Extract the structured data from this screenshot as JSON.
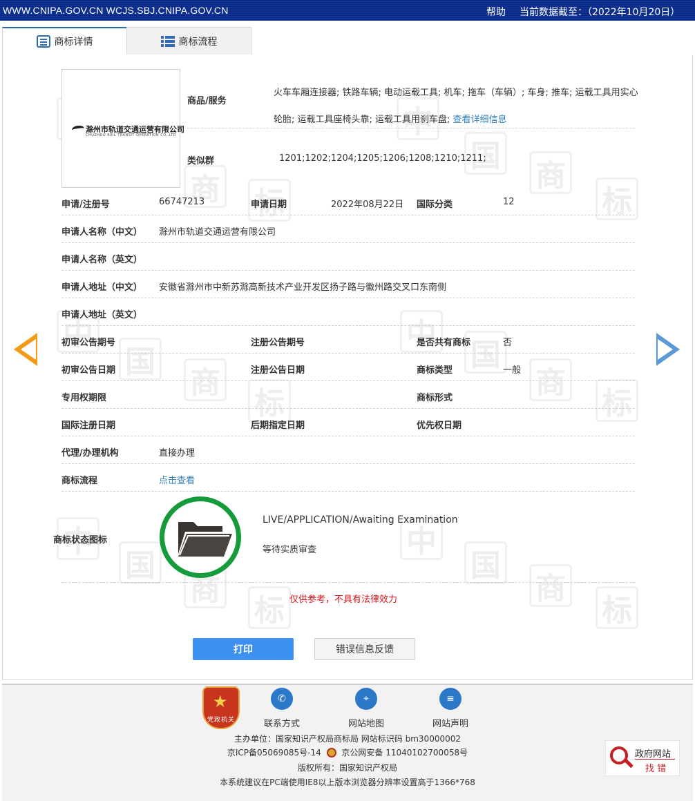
{
  "topbar": {
    "sites": "WWW.CNIPA.GOV.CN WCJS.SBJ.CNIPA.GOV.CN",
    "help": "帮助",
    "as_of": "当前数据截至：（2022年10月20日）"
  },
  "tabs": [
    {
      "label": "商标详情",
      "icon": "detail-icon",
      "active": true
    },
    {
      "label": "商标流程",
      "icon": "list-icon",
      "active": false
    }
  ],
  "watermark": [
    "中",
    "国",
    "商",
    "标"
  ],
  "trademark": {
    "logo_cn": "滁州市轨道交通运营有限公司",
    "logo_en": "CHUZHOU RAIL TRANSIT OPERATION CO.,LTD",
    "goods_label": "商品/服务",
    "goods_text": "火车车厢连接器; 铁路车辆; 电动运载工具; 机车; 拖车（车辆）; 车身; 推车; 运载工具用实心轮胎; 运载工具座椅头靠; 运载工具用刹车盘;",
    "goods_link": "查看详细信息",
    "similar_label": "类似群",
    "similar_value": "1201;1202;1204;1205;1206;1208;1210;1211;"
  },
  "fields": {
    "reg_no_label": "申请/注册号",
    "reg_no": "66747213",
    "apply_date_label": "申请日期",
    "apply_date": "2022年08月22日",
    "intl_class_label": "国际分类",
    "intl_class": "12",
    "applicant_cn_label": "申请人名称（中文）",
    "applicant_cn": "滁州市轨道交通运营有限公司",
    "applicant_en_label": "申请人名称（英文）",
    "applicant_en": "",
    "address_cn_label": "申请人地址（中文）",
    "address_cn": "安徽省滁州市中新苏滁高新技术产业开发区扬子路与徽州路交叉口东南侧",
    "address_en_label": "申请人地址（英文）",
    "address_en": "",
    "prelim_no_label": "初审公告期号",
    "reg_pub_no_label": "注册公告期号",
    "shared_label": "是否共有商标",
    "shared": "否",
    "prelim_date_label": "初审公告日期",
    "reg_pub_date_label": "注册公告日期",
    "type_label": "商标类型",
    "type": "一般",
    "exclusive_label": "专用权期限",
    "form_label": "商标形式",
    "intl_reg_label": "国际注册日期",
    "later_label": "后期指定日期",
    "priority_label": "优先权日期",
    "agent_label": "代理/办理机构",
    "agent": "直接办理",
    "flow_label": "商标流程",
    "flow_link": "点击查看",
    "status_label": "商标状态图标",
    "status_en": "LIVE/APPLICATION/Awaiting Examination",
    "status_cn": "等待实质审查"
  },
  "notice": "仅供参考，不具有法律效力",
  "buttons": {
    "print": "打印",
    "feedback": "错误信息反馈"
  },
  "footer": {
    "badge": "党政机关",
    "links": [
      {
        "label": "联系方式",
        "icon": "phone-icon"
      },
      {
        "label": "网站地图",
        "icon": "map-icon"
      },
      {
        "label": "网站声明",
        "icon": "document-icon"
      }
    ],
    "line1": "主办单位：国家知识产权局商标局  网站标识码 bm30000002",
    "icp": "京ICP备05069085号-14",
    "police": "京公网安备 11040102700058号",
    "line3": "版权所有：国家知识产权局",
    "line4": "本系统建议在PC端使用IE8以上版本浏览器分辨率设置高于1366*768",
    "gov_line1": "政府网站",
    "gov_line2": "找 错"
  },
  "colors": {
    "accent": "#2e6db5",
    "status_ring": "#159b3a",
    "notice": "#d9141b",
    "print_button": "#3d8ff0"
  }
}
